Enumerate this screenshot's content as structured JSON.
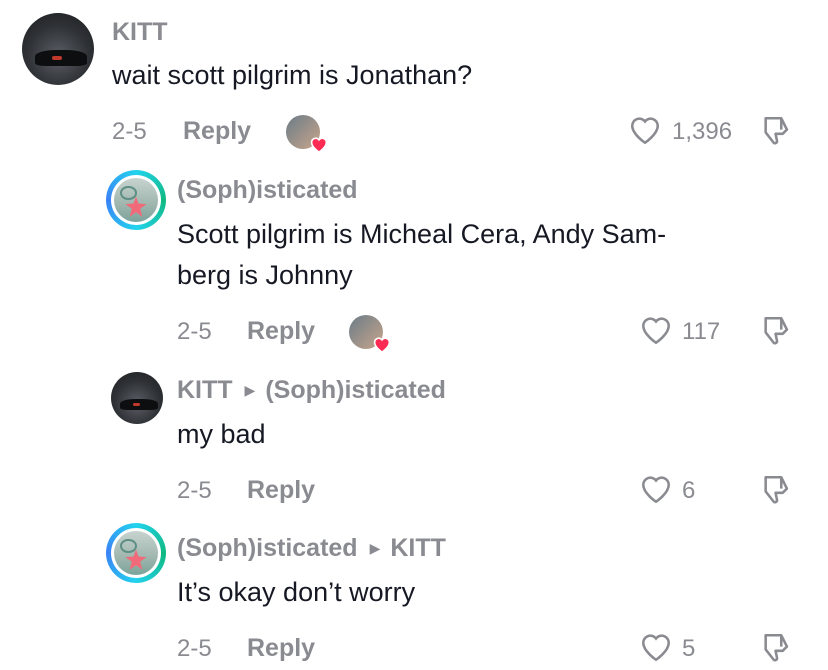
{
  "comments": [
    {
      "author": "KITT",
      "reply_to": "",
      "text": "wait scott pilgrim is Jonathan?",
      "date": "2-5",
      "reply_label": "Reply",
      "likes": "1,396",
      "liked_by_creator": true
    },
    {
      "author": "(Soph)isticated",
      "reply_to": "",
      "text_line1": "Scott pilgrim is Micheal Cera, Andy Sam-",
      "text_line2": "berg is Johnny",
      "date": "2-5",
      "reply_label": "Reply",
      "likes": "117",
      "liked_by_creator": true
    },
    {
      "author": "KITT",
      "reply_to": "(Soph)isticated",
      "text": "my bad",
      "date": "2-5",
      "reply_label": "Reply",
      "likes": "6",
      "liked_by_creator": false
    },
    {
      "author": "(Soph)isticated",
      "reply_to": "KITT",
      "text": "It’s okay don’t worry",
      "date": "2-5",
      "reply_label": "Reply",
      "likes": "5",
      "liked_by_creator": false
    }
  ],
  "icons": {
    "like": "heart-outline-icon",
    "dislike": "thumbs-down-icon",
    "reply_arrow": "triangle-right-icon",
    "creator_heart": "heart-filled-icon"
  },
  "colors": {
    "heart_red": "#fe2c55",
    "muted_text": "#8a8b91",
    "primary_text": "#161823",
    "story_ring": "#22d3ee"
  }
}
